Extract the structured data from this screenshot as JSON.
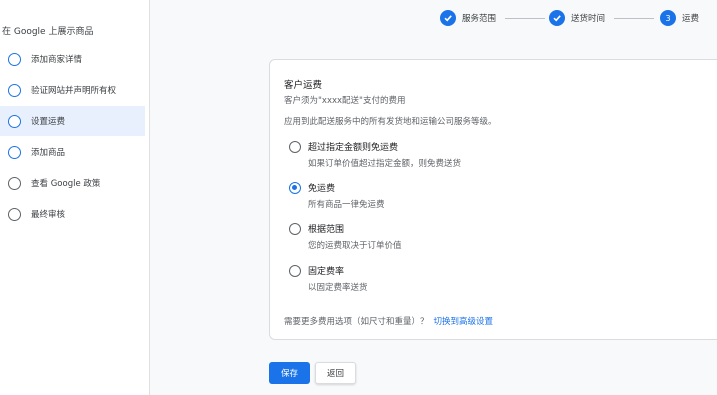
{
  "sidebar": {
    "title": "在 Google 上展示商品",
    "items": [
      {
        "label": "添加商家详情",
        "state": "todo"
      },
      {
        "label": "验证网站并声明所有权",
        "state": "todo"
      },
      {
        "label": "设置运费",
        "state": "active"
      },
      {
        "label": "添加商品",
        "state": "todo"
      },
      {
        "label": "查看 Google 政策",
        "state": "disabled"
      },
      {
        "label": "最终审核",
        "state": "disabled"
      }
    ]
  },
  "stepper": {
    "steps": [
      {
        "label": "服务范围",
        "indicator": "check-icon",
        "status": "done"
      },
      {
        "label": "送货时间",
        "indicator": "check-icon",
        "status": "done"
      },
      {
        "label": "运费",
        "indicator": "3",
        "status": "current"
      }
    ]
  },
  "card": {
    "title": "客户运费",
    "subtitle": "客户须为\"xxxx配送\"支付的费用",
    "description": "应用到此配送服务中的所有发货地和运输公司服务等级。",
    "options": [
      {
        "label": "超过指定金额则免运费",
        "description": "如果订单价值超过指定金额，则免费送货",
        "selected": false
      },
      {
        "label": "免运费",
        "description": "所有商品一律免运费",
        "selected": true
      },
      {
        "label": "根据范围",
        "description": "您的运费取决于订单价值",
        "selected": false
      },
      {
        "label": "固定费率",
        "description": "以固定费率送货",
        "selected": false
      }
    ],
    "more_text": "需要更多费用选项（如尺寸和重量）？",
    "more_link": "切换到高级设置"
  },
  "actions": {
    "save_label": "保存",
    "back_label": "返回"
  },
  "colors": {
    "accent": "#1a73e8",
    "active_bg": "#e8f0fe"
  }
}
